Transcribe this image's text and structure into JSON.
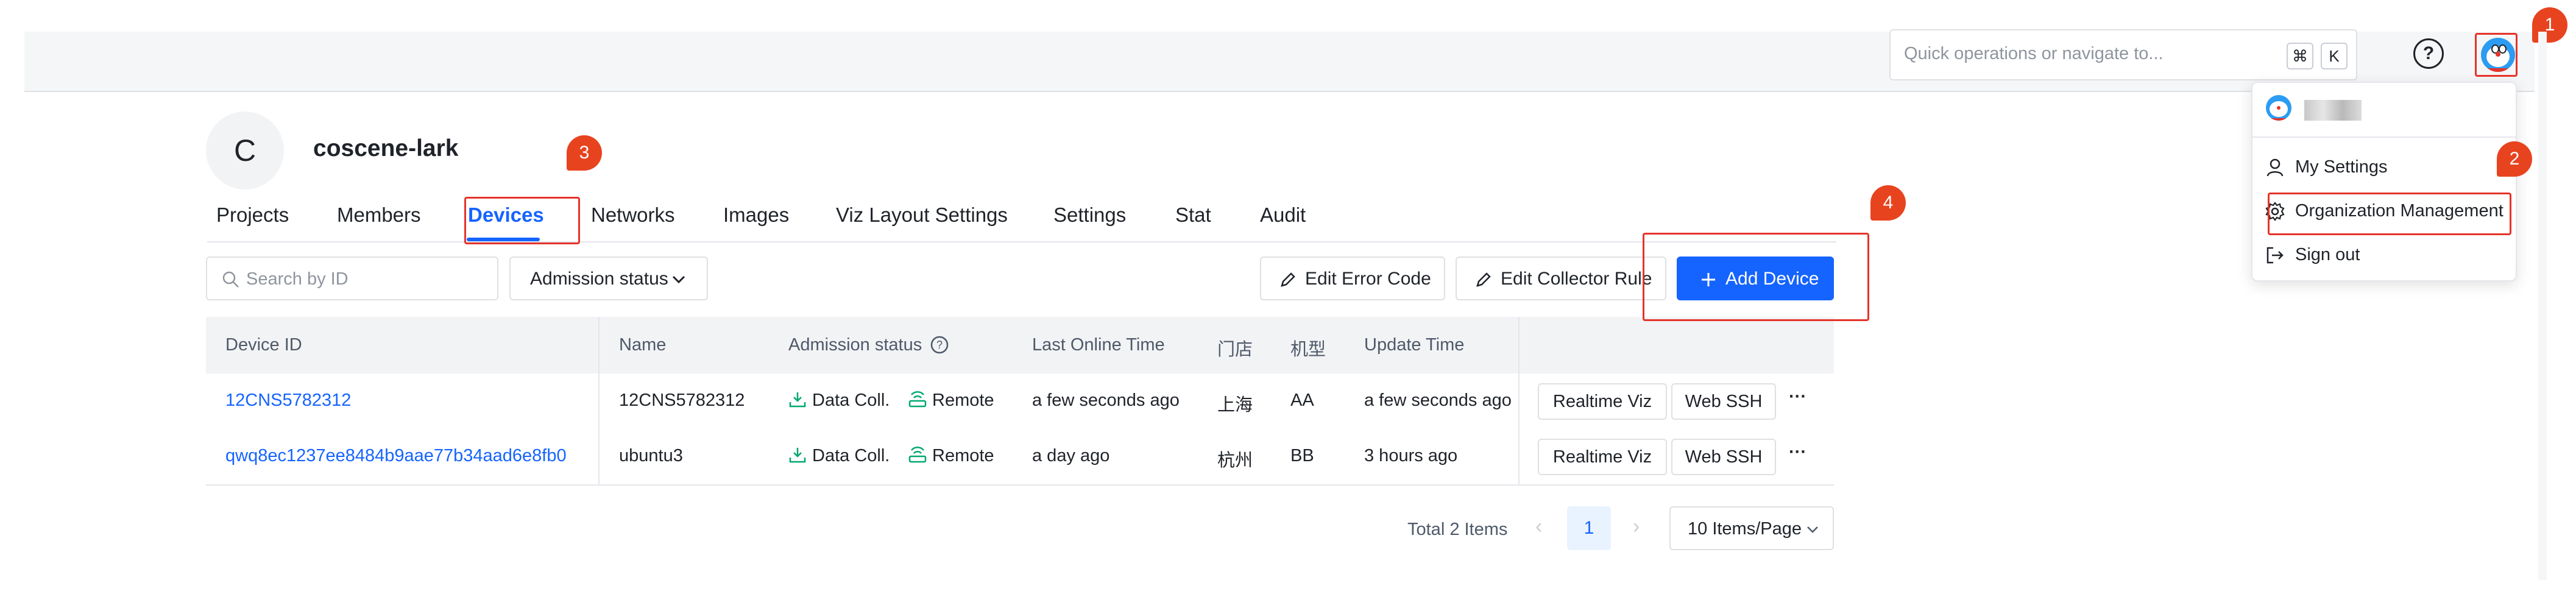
{
  "header": {
    "quick_search_placeholder": "Quick operations or navigate to...",
    "shortcut_keys": [
      "⌘",
      "K"
    ],
    "help_label": "?"
  },
  "org": {
    "initial": "C",
    "name": "coscene-lark"
  },
  "tabs": [
    {
      "label": "Projects",
      "active": false
    },
    {
      "label": "Members",
      "active": false
    },
    {
      "label": "Devices",
      "active": true
    },
    {
      "label": "Networks",
      "active": false
    },
    {
      "label": "Images",
      "active": false
    },
    {
      "label": "Viz Layout Settings",
      "active": false
    },
    {
      "label": "Settings",
      "active": false
    },
    {
      "label": "Stat",
      "active": false
    },
    {
      "label": "Audit",
      "active": false
    }
  ],
  "toolbar": {
    "search_placeholder": "Search by ID",
    "admission_filter_label": "Admission status",
    "edit_error_code_label": "Edit Error Code",
    "edit_collector_rule_label": "Edit Collector Rule",
    "add_device_label": "Add Device"
  },
  "table": {
    "columns": [
      "Device ID",
      "Name",
      "Admission status",
      "Last Online Time",
      "门店",
      "机型",
      "Update Time"
    ],
    "rows": [
      {
        "device_id": "12CNS5782312",
        "name": "12CNS5782312",
        "status_data": "Data Coll.",
        "status_remote": "Remote",
        "last_online": "a few seconds ago",
        "store": "上海",
        "model": "AA",
        "update_time": "a few seconds ago",
        "action_viz": "Realtime Viz",
        "action_ssh": "Web SSH",
        "action_more": "···"
      },
      {
        "device_id": "qwq8ec1237ee8484b9aae77b34aad6e8fb0",
        "name": "ubuntu3",
        "status_data": "Data Coll.",
        "status_remote": "Remote",
        "last_online": "a day ago",
        "store": "杭州",
        "model": "BB",
        "update_time": "3 hours ago",
        "action_viz": "Realtime Viz",
        "action_ssh": "Web SSH",
        "action_more": "···"
      }
    ]
  },
  "pagination": {
    "total_text": "Total 2 Items",
    "prev": "‹",
    "current_page": "1",
    "next": "›",
    "page_size_label": "10 Items/Page"
  },
  "user_menu": {
    "items": [
      {
        "label": "My Settings",
        "icon": "user-icon"
      },
      {
        "label": "Organization Management",
        "icon": "gear-icon"
      },
      {
        "label": "Sign out",
        "icon": "logout-icon"
      }
    ]
  },
  "annotations": [
    "1",
    "2",
    "3",
    "4"
  ],
  "colors": {
    "primary": "#1664ff",
    "annotation": "#e5332a",
    "status_green": "#00a870"
  }
}
